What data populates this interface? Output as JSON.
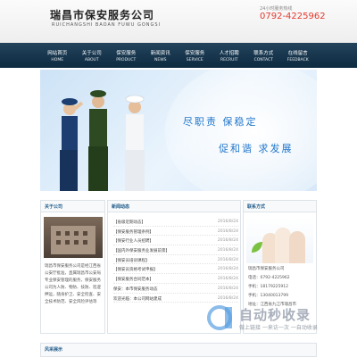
{
  "header": {
    "logo_cn": "瑞昌市保安服务公司",
    "logo_en": "RUICHANGSHI BAOAN FUWU GONGSI",
    "hotline_label": "24小时服务热线",
    "hotline_number": "0792-4225962"
  },
  "nav": {
    "items": [
      {
        "cn": "网站首页",
        "en": "HOME"
      },
      {
        "cn": "关于公司",
        "en": "ABOUT"
      },
      {
        "cn": "保安服务",
        "en": "PRODUCT"
      },
      {
        "cn": "新闻资讯",
        "en": "NEWS"
      },
      {
        "cn": "保安服务",
        "en": "SERVICE"
      },
      {
        "cn": "人才招聘",
        "en": "RECRUIT"
      },
      {
        "cn": "联系方式",
        "en": "CONTACT"
      },
      {
        "cn": "在线留言",
        "en": "FEEDBACK"
      }
    ]
  },
  "banner": {
    "slogan1": "尽职责 保稳定",
    "slogan2": "促和谐 求发展"
  },
  "about": {
    "title": "关于公司",
    "text": "瑞昌市保安服务公司是经江西省公安厅批准，直属瑞昌市公安局专业保安管理的服务，保安服务公司为人防、物防、技防、巡逻押运，随身护卫、安全检查、安全技术防范、安全风险评估等"
  },
  "news": {
    "title": "新闻动态",
    "items": [
      {
        "title": "【省级近期动态】",
        "date": "2016/8/24"
      },
      {
        "title": "【保安服务管理条例】",
        "date": "2016/8/24"
      },
      {
        "title": "【保安行业人员招聘】",
        "date": "2016/8/24"
      },
      {
        "title": "【国内外保安服务业发展前景】",
        "date": "2016/8/24"
      },
      {
        "title": "【保安员培训课程】",
        "date": "2016/8/24"
      },
      {
        "title": "【保安员资格考试申报】",
        "date": "2016/8/24"
      },
      {
        "title": "【保安服务合同范本】",
        "date": "2016/8/24"
      },
      {
        "title": "保安：本市保安服务动态",
        "date": "2016/8/24"
      },
      {
        "title": "欢迎光临：本公司网站建成",
        "date": "2016/8/24"
      }
    ]
  },
  "contact": {
    "title": "联系方式",
    "lines": [
      "瑞昌市保安服务公司",
      "电话：0792-4225962",
      "手机：18179225912",
      "手机：13040013799",
      "地址：江西省九江市瑞昌市"
    ]
  },
  "watermark": {
    "text": "自动秒收录",
    "sub": "做上链接 一来访一次 一自动收录"
  },
  "gallery": {
    "title": "风采展示"
  },
  "colors": {
    "nav_bg": "#0d2b41",
    "hotline": "#e23a2e",
    "slogan": "#2277cc",
    "section_title": "#1e5a8a"
  }
}
